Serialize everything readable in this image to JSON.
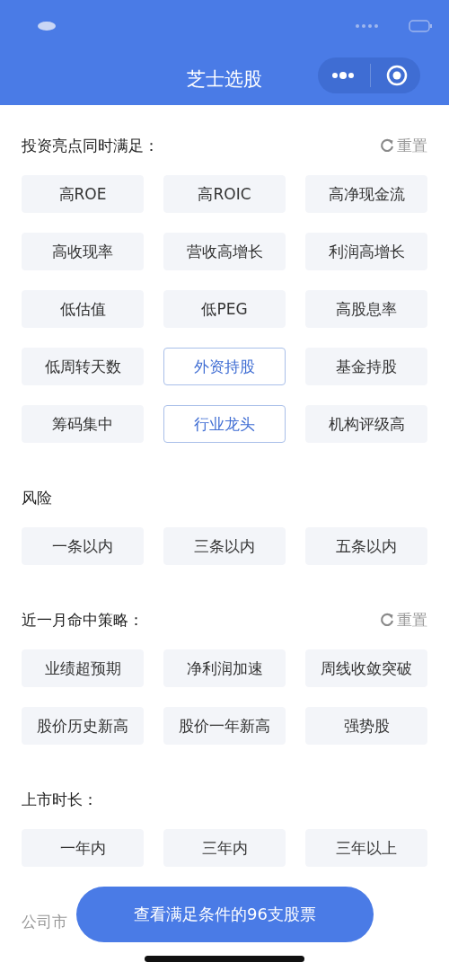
{
  "title": "芝士选股",
  "sections": [
    {
      "heading": "投资亮点同时满足：",
      "reset": "重置",
      "chips": [
        {
          "label": "高ROE",
          "selected": false
        },
        {
          "label": "高ROIC",
          "selected": false
        },
        {
          "label": "高净现金流",
          "selected": false
        },
        {
          "label": "高收现率",
          "selected": false
        },
        {
          "label": "营收高增长",
          "selected": false
        },
        {
          "label": "利润高增长",
          "selected": false
        },
        {
          "label": "低估值",
          "selected": false
        },
        {
          "label": "低PEG",
          "selected": false
        },
        {
          "label": "高股息率",
          "selected": false
        },
        {
          "label": "低周转天数",
          "selected": false
        },
        {
          "label": "外资持股",
          "selected": true
        },
        {
          "label": "基金持股",
          "selected": false
        },
        {
          "label": "筹码集中",
          "selected": false
        },
        {
          "label": "行业龙头",
          "selected": true
        },
        {
          "label": "机构评级高",
          "selected": false
        }
      ]
    },
    {
      "heading": "风险",
      "chips": [
        {
          "label": "一条以内",
          "selected": false
        },
        {
          "label": "三条以内",
          "selected": false
        },
        {
          "label": "五条以内",
          "selected": false
        }
      ]
    },
    {
      "heading": "近一月命中策略：",
      "reset": "重置",
      "chips": [
        {
          "label": "业绩超预期",
          "selected": false
        },
        {
          "label": "净利润加速",
          "selected": false
        },
        {
          "label": "周线收敛突破",
          "selected": false
        },
        {
          "label": "股价历史新高",
          "selected": false
        },
        {
          "label": "股价一年新高",
          "selected": false
        },
        {
          "label": "强势股",
          "selected": false
        }
      ]
    },
    {
      "heading": "上市时长：",
      "chips": [
        {
          "label": "一年内",
          "selected": false
        },
        {
          "label": "三年内",
          "selected": false
        },
        {
          "label": "三年以上",
          "selected": false
        }
      ]
    },
    {
      "heading": "公司市"
    }
  ],
  "action_button": "查看满足条件的96支股票"
}
